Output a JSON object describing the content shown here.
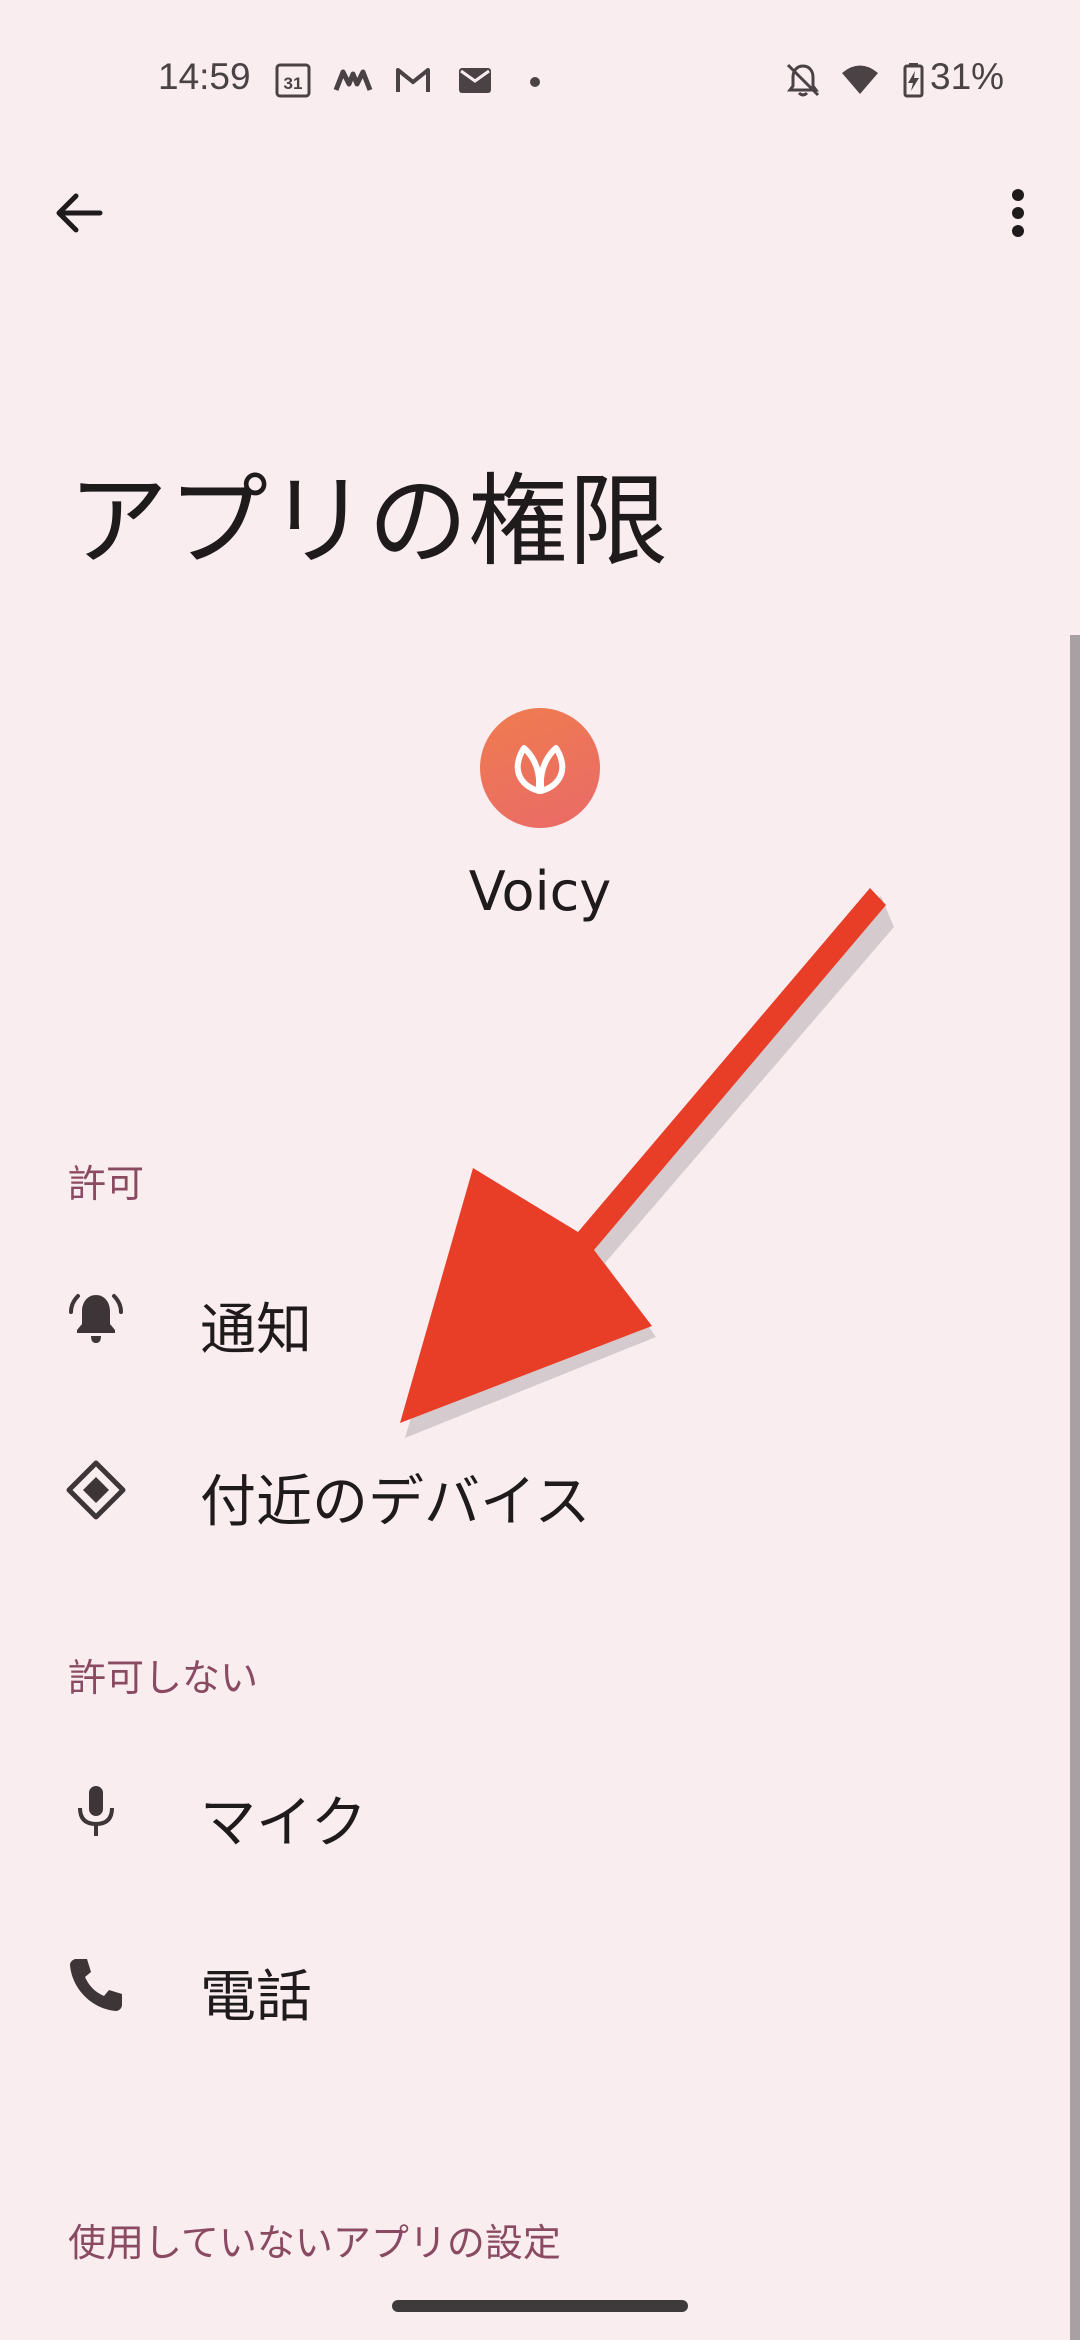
{
  "status_bar": {
    "time": "14:59",
    "battery_percent": "31%",
    "calendar_day": "31",
    "icons": [
      "calendar-icon",
      "app-notification-icon",
      "gmail-icon",
      "mail-icon",
      "dot-icon",
      "bell-off-icon",
      "wifi-icon",
      "battery-charging-icon"
    ]
  },
  "app_bar": {
    "back_icon": "back-arrow-icon",
    "menu_icon": "more-vert-icon"
  },
  "page": {
    "title": "アプリの権限",
    "app_name": "Voicy",
    "app_icon": "voicy-leaf-icon"
  },
  "sections": {
    "allowed": {
      "header": "許可",
      "items": [
        {
          "label": "通知",
          "icon": "bell-icon"
        },
        {
          "label": "付近のデバイス",
          "icon": "nearby-devices-icon"
        }
      ]
    },
    "denied": {
      "header": "許可しない",
      "items": [
        {
          "label": "マイク",
          "icon": "mic-icon"
        },
        {
          "label": "電話",
          "icon": "phone-icon"
        }
      ]
    },
    "unused_settings": {
      "header": "使用していないアプリの設定"
    }
  },
  "colors": {
    "background": "#f9edf0",
    "section_header": "#8a4a62",
    "app_icon_gradient_start": "#ef7c4f",
    "app_icon_gradient_end": "#ea6a68",
    "annotation_arrow": "#e83e27"
  }
}
